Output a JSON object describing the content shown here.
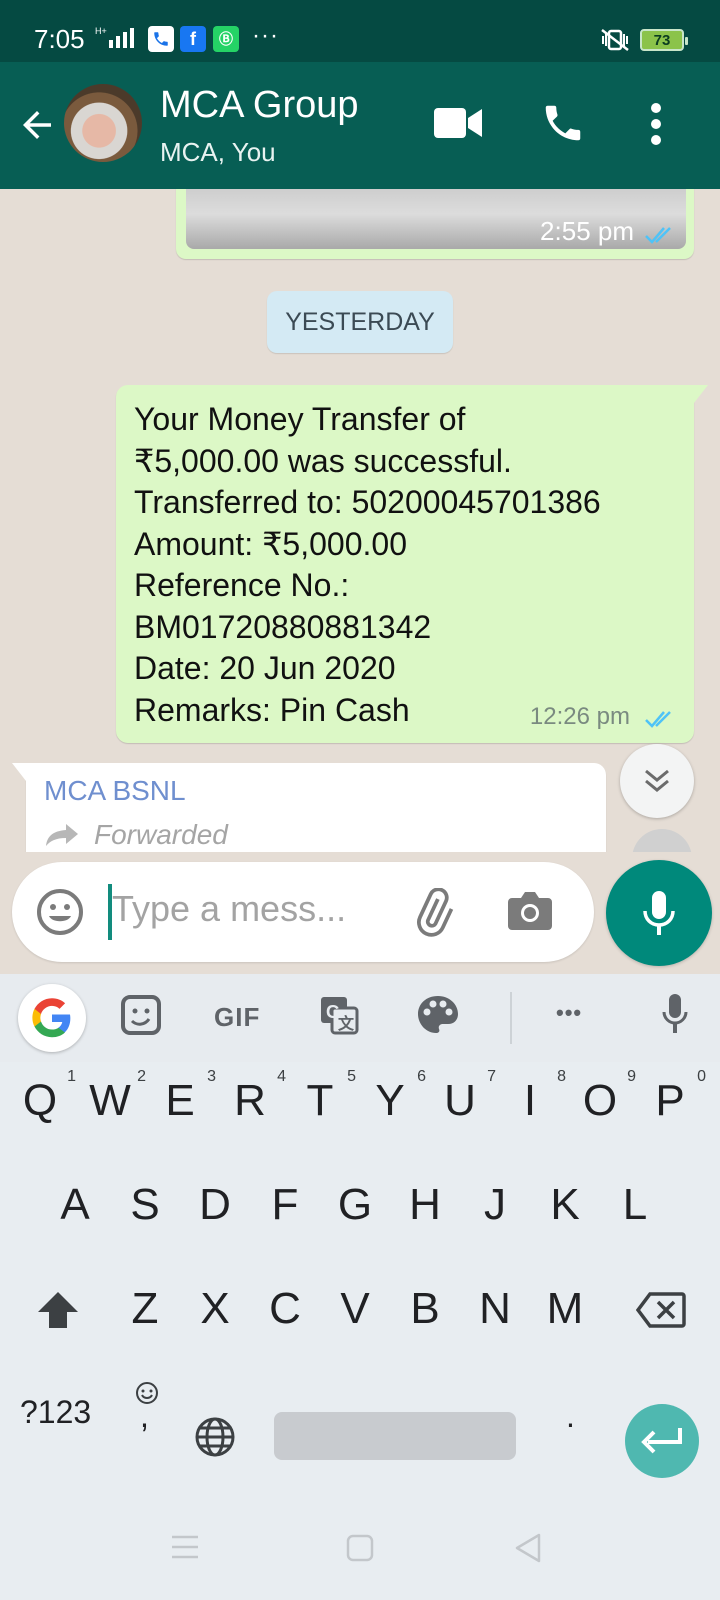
{
  "status_bar": {
    "time": "7:05",
    "more": "···",
    "battery": "73"
  },
  "header": {
    "title": "MCA Group",
    "subtitle": "MCA, You"
  },
  "chat": {
    "image_message_time": "2:55 pm",
    "date_divider": "YESTERDAY",
    "outgoing_message": {
      "lines": [
        "Your Money Transfer of",
        "₹5,000.00 was successful.",
        "Transferred to: 50200045701386",
        "Amount: ₹5,000.00",
        "Reference No.:",
        "BM01720880881342",
        "Date: 20 Jun 2020",
        "Remarks: Pin Cash"
      ],
      "time": "12:26 pm"
    },
    "incoming_message": {
      "sender": "MCA BSNL",
      "forwarded_label": "Forwarded"
    }
  },
  "composer": {
    "placeholder": "Type a mess..."
  },
  "keyboard": {
    "toolbar": {
      "gif_label": "GIF",
      "more": "•••"
    },
    "row1": [
      {
        "k": "Q",
        "n": "1"
      },
      {
        "k": "W",
        "n": "2"
      },
      {
        "k": "E",
        "n": "3"
      },
      {
        "k": "R",
        "n": "4"
      },
      {
        "k": "T",
        "n": "5"
      },
      {
        "k": "Y",
        "n": "6"
      },
      {
        "k": "U",
        "n": "7"
      },
      {
        "k": "I",
        "n": "8"
      },
      {
        "k": "O",
        "n": "9"
      },
      {
        "k": "P",
        "n": "0"
      }
    ],
    "row2": [
      "A",
      "S",
      "D",
      "F",
      "G",
      "H",
      "J",
      "K",
      "L"
    ],
    "row3": [
      "Z",
      "X",
      "C",
      "V",
      "B",
      "N",
      "M"
    ],
    "symbols_key": "?123",
    "comma_key": ",",
    "period_key": "."
  },
  "colors": {
    "status_bar": "#054a42",
    "header": "#075e54",
    "outgoing_bubble": "#dcf8c6",
    "read_ticks": "#4fc3f7",
    "accent": "#00897b"
  }
}
